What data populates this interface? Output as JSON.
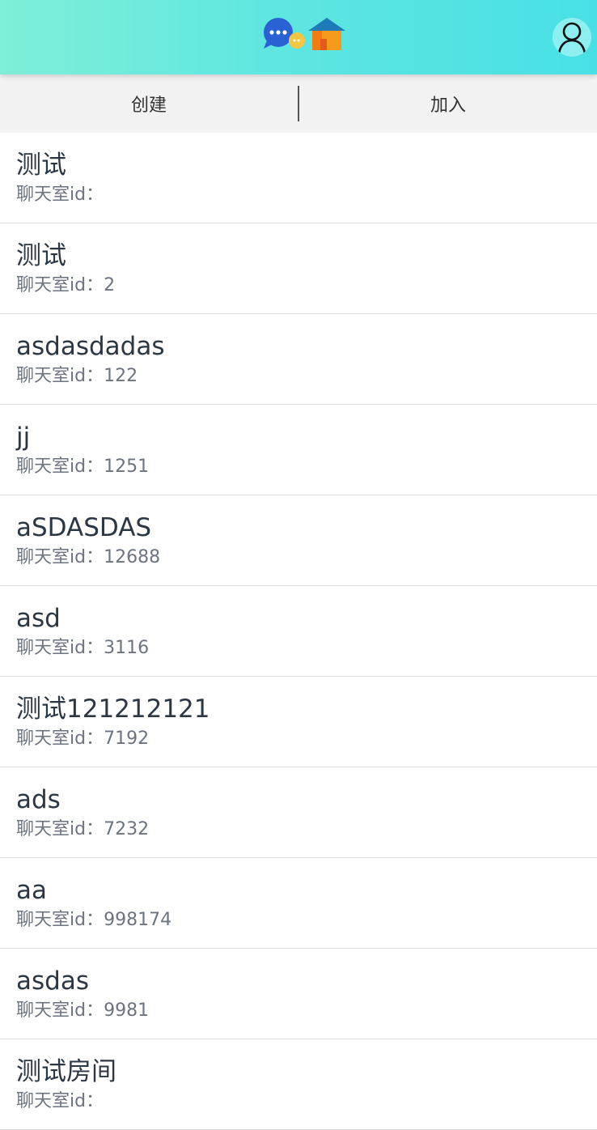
{
  "header": {
    "logo_icon": "chat-home-logo-icon",
    "user_icon": "user-avatar-icon"
  },
  "tabs": [
    {
      "label": "创建"
    },
    {
      "label": "加入"
    }
  ],
  "id_prefix": "聊天室id：",
  "rooms": [
    {
      "name": "测试",
      "id": "",
      "prefix": "聊天室id："
    },
    {
      "name": "测试",
      "id": "2",
      "prefix": "聊天室id："
    },
    {
      "name": "asdasdadas",
      "id": "122",
      "prefix": "聊天室id："
    },
    {
      "name": "jj",
      "id": "1251",
      "prefix": "聊天室id："
    },
    {
      "name": "aSDASDAS",
      "id": "12688",
      "prefix": "聊天室id："
    },
    {
      "name": "asd",
      "id": "3116",
      "prefix": "聊天室id："
    },
    {
      "name": "测试121212121",
      "id": "7192",
      "prefix": "聊天室id："
    },
    {
      "name": "ads",
      "id": "7232",
      "prefix": "聊天室id："
    },
    {
      "name": "aa",
      "id": "998174",
      "prefix": "聊天室id："
    },
    {
      "name": "asdas",
      "id": "9981",
      "prefix": "聊天室id："
    },
    {
      "name": "测试房间",
      "id": "",
      "prefix": "聊天室id："
    }
  ],
  "colors": {
    "header_gradient_start": "#7eefd8",
    "header_gradient_end": "#48e0e6",
    "tab_bar": "#f2f2f2",
    "room_name": "#2c3744",
    "room_id": "#6b7480"
  }
}
